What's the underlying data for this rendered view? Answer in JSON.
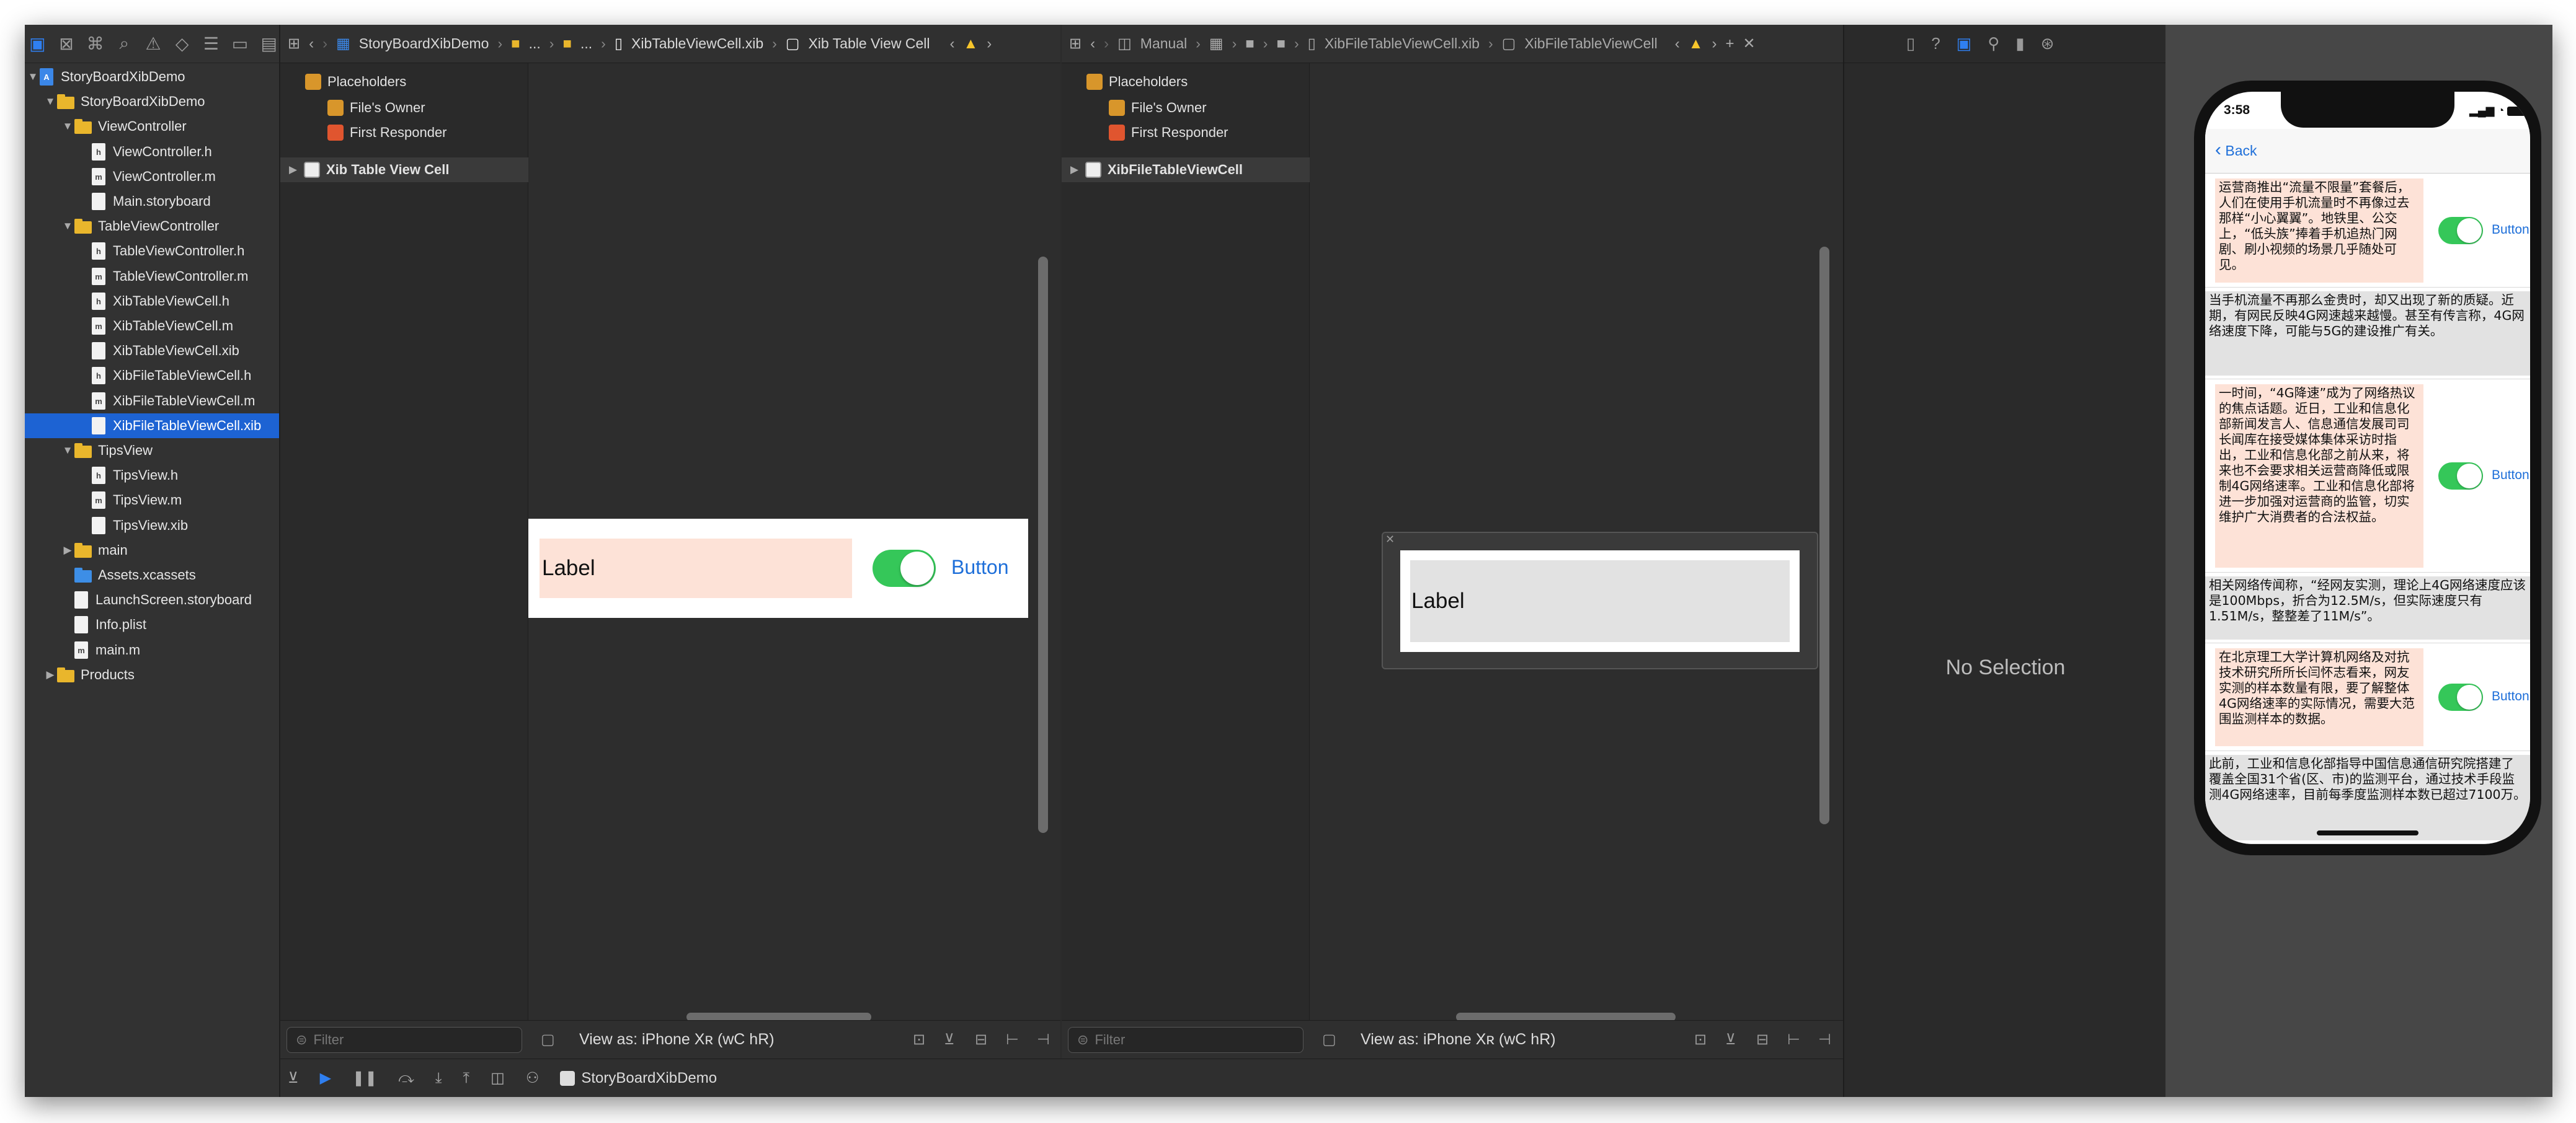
{
  "navigator": {
    "toolbar_icons": [
      "folder-icon",
      "source-control-icon",
      "hierarchy-icon",
      "find-icon",
      "issue-icon",
      "test-icon",
      "debug-icon",
      "breakpoint-icon",
      "report-icon"
    ],
    "items": [
      {
        "label": "StoryBoardXibDemo",
        "kind": "project",
        "disclosure": "open"
      },
      {
        "label": "StoryBoardXibDemo",
        "kind": "folder",
        "disclosure": "open"
      },
      {
        "label": "ViewController",
        "kind": "folder",
        "disclosure": "open"
      },
      {
        "label": "ViewController.h",
        "kind": "h"
      },
      {
        "label": "ViewController.m",
        "kind": "m"
      },
      {
        "label": "Main.storyboard",
        "kind": "storyboard"
      },
      {
        "label": "TableViewController",
        "kind": "folder",
        "disclosure": "open"
      },
      {
        "label": "TableViewController.h",
        "kind": "h"
      },
      {
        "label": "TableViewController.m",
        "kind": "m"
      },
      {
        "label": "XibTableViewCell.h",
        "kind": "h"
      },
      {
        "label": "XibTableViewCell.m",
        "kind": "m"
      },
      {
        "label": "XibTableViewCell.xib",
        "kind": "xib"
      },
      {
        "label": "XibFileTableViewCell.h",
        "kind": "h"
      },
      {
        "label": "XibFileTableViewCell.m",
        "kind": "m"
      },
      {
        "label": "XibFileTableViewCell.xib",
        "kind": "xib",
        "selected": true
      },
      {
        "label": "TipsView",
        "kind": "folder",
        "disclosure": "open"
      },
      {
        "label": "TipsView.h",
        "kind": "h"
      },
      {
        "label": "TipsView.m",
        "kind": "m"
      },
      {
        "label": "TipsView.xib",
        "kind": "xib"
      },
      {
        "label": "main",
        "kind": "folder",
        "disclosure": "closed"
      },
      {
        "label": "Assets.xcassets",
        "kind": "assets"
      },
      {
        "label": "LaunchScreen.storyboard",
        "kind": "storyboard"
      },
      {
        "label": "Info.plist",
        "kind": "plist"
      },
      {
        "label": "main.m",
        "kind": "m"
      },
      {
        "label": "Products",
        "kind": "folder",
        "disclosure": "closed"
      }
    ],
    "status_scheme": "StoryBoardXibDemo"
  },
  "editor1": {
    "breadcrumb": [
      "StoryBoardXibDemo",
      "...",
      "...",
      "XibTableViewCell.xib",
      "Xib Table View Cell"
    ],
    "outline": {
      "placeholders": "Placeholders",
      "files_owner": "File's Owner",
      "first_responder": "First Responder",
      "cell": "Xib Table View Cell"
    },
    "cell_label": "Label",
    "cell_button": "Button",
    "filter_placeholder": "Filter",
    "view_as": "View as: iPhone Xʀ (wC hR)"
  },
  "editor2": {
    "breadcrumb": [
      "Manual",
      "XibFileTableViewCell.xib",
      "XibFileTableViewCell"
    ],
    "outline": {
      "placeholders": "Placeholders",
      "files_owner": "File's Owner",
      "first_responder": "First Responder",
      "cell": "XibFileTableViewCell"
    },
    "cell_label": "Label",
    "filter_placeholder": "Filter",
    "view_as": "View as: iPhone Xʀ (wC hR)"
  },
  "inspector": {
    "empty": "No Selection"
  },
  "simulator": {
    "time": "3:58",
    "back": "Back",
    "button_label": "Button",
    "cells": [
      {
        "style": "pink",
        "toggle": true,
        "text": "运营商推出“流量不限量”套餐后，人们在使用手机流量时不再像过去那样“小心翼翼”。地铁里、公交上，“低头族”捧着手机追热门网剧、刷小视频的场景几乎随处可见。"
      },
      {
        "style": "gray",
        "toggle": false,
        "text": "当手机流量不再那么金贵时，却又出现了新的质疑。近期，有网民反映4G网速越来越慢。甚至有传言称，4G网络速度下降，可能与5G的建设推广有关。"
      },
      {
        "style": "pink",
        "toggle": true,
        "text": "一时间，“4G降速”成为了网络热议的焦点话题。近日，工业和信息化部新闻发言人、信息通信发展司司长闻库在接受媒体集体采访时指出，工业和信息化部之前从来，将来也不会要求相关运营商降低或限制4G网络速率。工业和信息化部将进一步加强对运营商的监管，切实维护广大消费者的合法权益。"
      },
      {
        "style": "gray",
        "toggle": false,
        "text": "相关网络传闻称，“经网友实测，理论上4G网络速度应该是100Mbps，折合为12.5M/s，但实际速度只有1.51M/s，整整差了11M/s”。"
      },
      {
        "style": "pink",
        "toggle": true,
        "text": "在北京理工大学计算机网络及对抗技术研究所所长闫怀志看来，网友实测的样本数量有限，要了解整体4G网络速率的实际情况，需要大范围监测样本的数据。"
      },
      {
        "style": "gray",
        "toggle": false,
        "text": "此前，工业和信息化部指导中国信息通信研究院搭建了覆盖全国31个省(区、市)的监测平台，通过技术手段监测4G网络速率，目前每季度监测样本数已超过7100万。"
      }
    ]
  }
}
